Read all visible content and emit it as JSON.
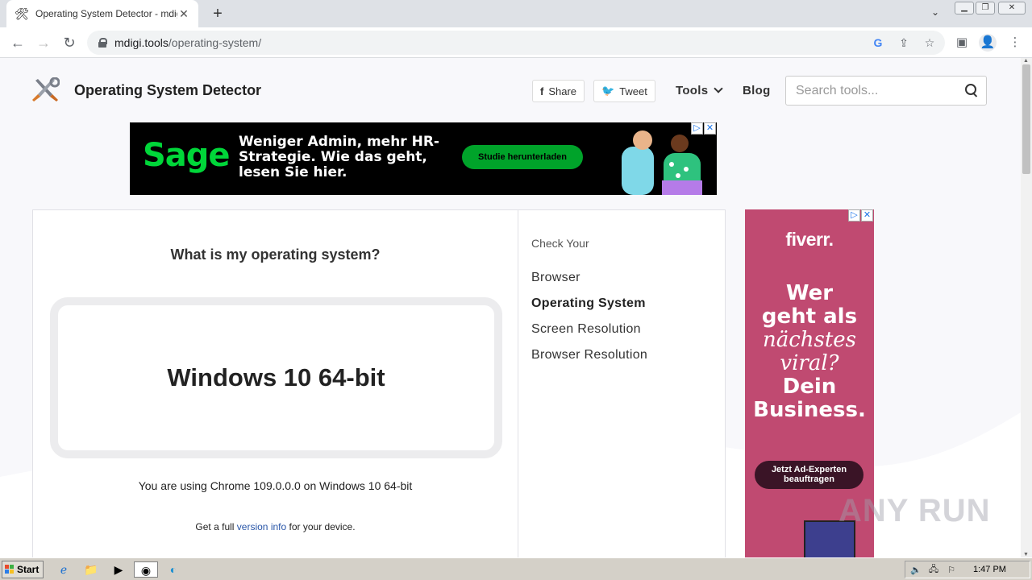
{
  "browser": {
    "tab_title": "Operating System Detector - mdigi.tools",
    "tab_close": "✕",
    "new_tab": "+",
    "url_host": "mdigi.tools",
    "url_path": "/operating-system/"
  },
  "header": {
    "site_title": "Operating System Detector",
    "share_label": "Share",
    "tweet_label": "Tweet",
    "nav_tools": "Tools",
    "nav_blog": "Blog",
    "search_placeholder": "Search tools..."
  },
  "top_ad": {
    "brand": "Sage",
    "headline": "Weniger Admin, mehr HR-Strategie. Wie das geht, lesen Sie hier.",
    "cta": "Studie herunterladen"
  },
  "main": {
    "question": "What is my operating system?",
    "os_result": "Windows 10 64-bit",
    "ua_sentence": "You are using Chrome 109.0.0.0 on Windows 10 64-bit",
    "full_info_prefix": "Get a full",
    "full_info_link": "version info",
    "full_info_suffix": "for your device."
  },
  "sidebar": {
    "heading": "Check Your",
    "links": [
      {
        "label": "Browser",
        "active": false
      },
      {
        "label": "Operating System",
        "active": true
      },
      {
        "label": "Screen Resolution",
        "active": false
      },
      {
        "label": "Browser Resolution",
        "active": false
      }
    ]
  },
  "side_ad": {
    "brand": "fiverr.",
    "line1": "Wer",
    "line2": "geht als",
    "line3": "nächstes",
    "line4": "viral?",
    "line5": "Dein",
    "line6": "Business.",
    "cta": "Jetzt Ad-Experten beauftragen"
  },
  "watermark": "ANY RUN",
  "taskbar": {
    "start_label": "Start",
    "clock": "1:47 PM"
  },
  "colors": {
    "sage_green": "#00d639",
    "fiverr_pink": "#c04a71",
    "link_blue": "#2855a8"
  }
}
